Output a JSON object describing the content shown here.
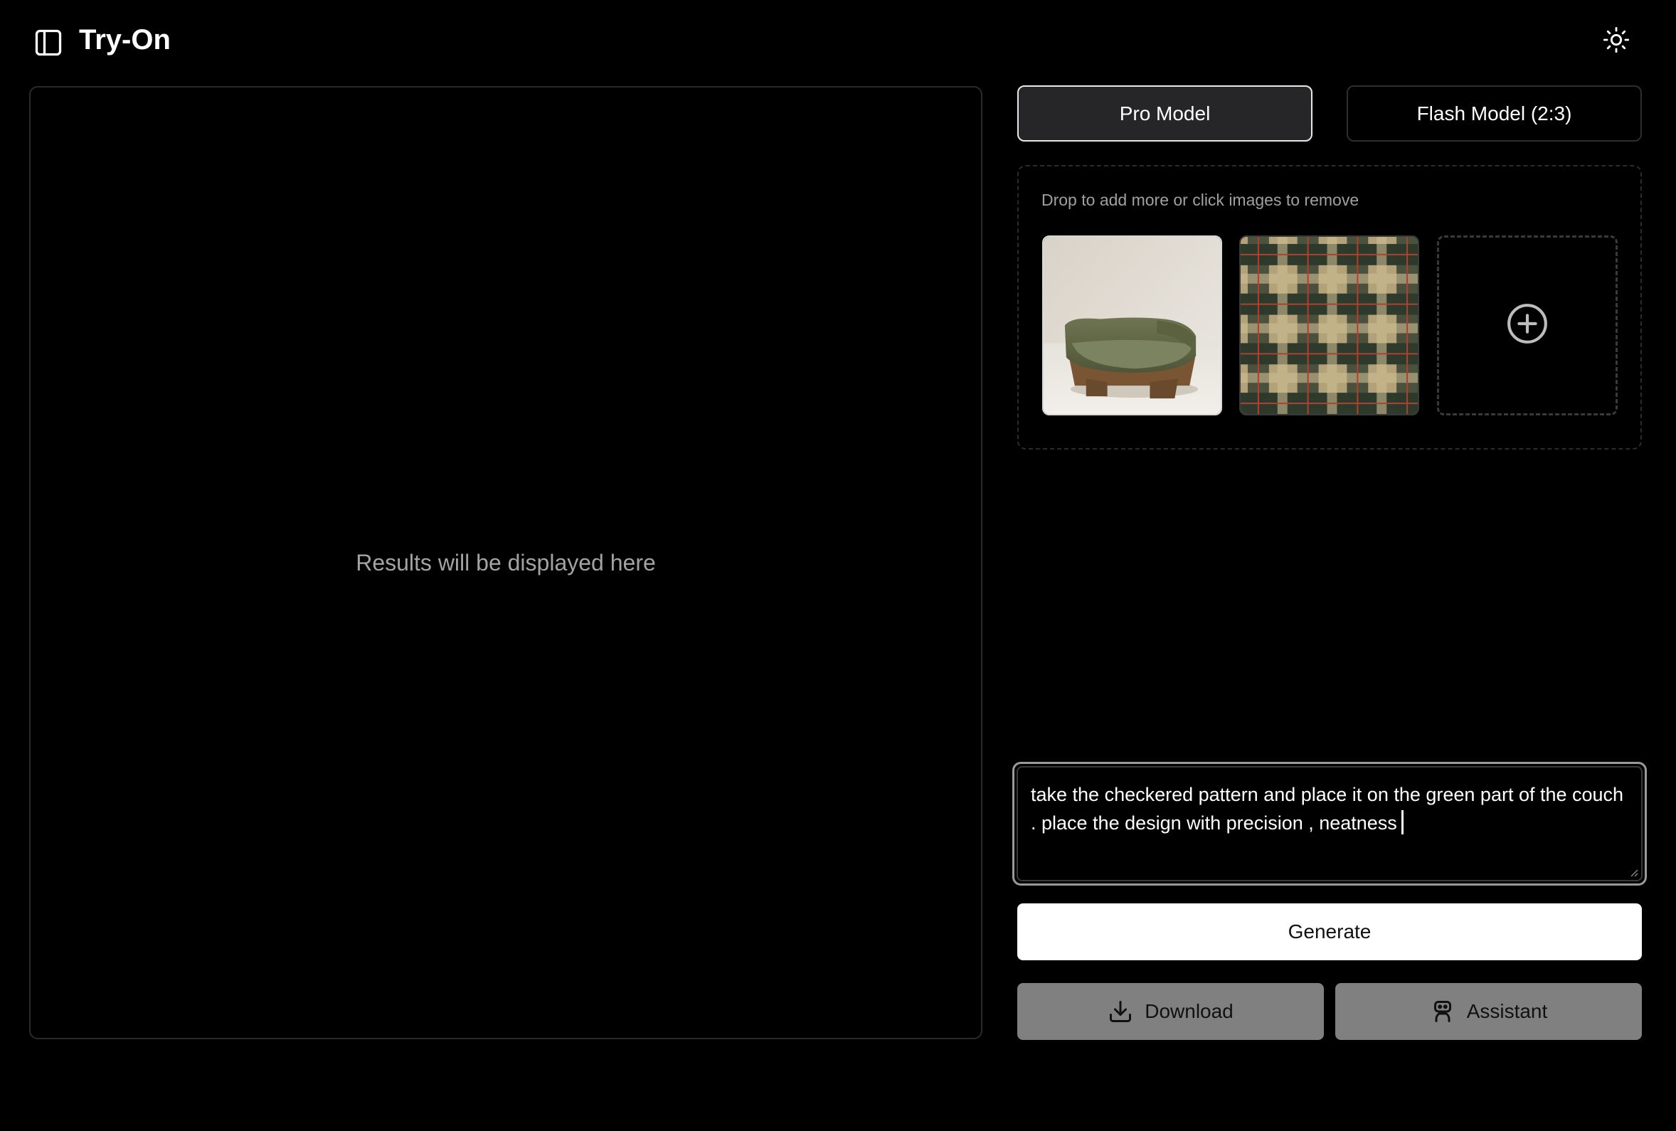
{
  "header": {
    "title": "Try-On",
    "sidebar_toggle_icon": "sidebar-panel-icon",
    "theme_toggle_icon": "sun-icon"
  },
  "results": {
    "placeholder": "Results will be displayed here"
  },
  "models": {
    "pro_label": "Pro Model",
    "flash_label": "Flash Model (2:3)",
    "selected": "Pro Model"
  },
  "dropzone": {
    "hint": "Drop to add more or click images to remove",
    "images": [
      {
        "name": "couch-image"
      },
      {
        "name": "plaid-pattern-image"
      }
    ],
    "add_icon": "plus-circle-icon"
  },
  "prompt": {
    "value": "take the checkered pattern and place it on the green part of the couch . place the design with precision , neatness"
  },
  "actions": {
    "generate_label": "Generate",
    "download_label": "Download",
    "download_icon": "download-icon",
    "assistant_label": "Assistant",
    "assistant_icon": "robot-icon"
  },
  "colors": {
    "background": "#000000",
    "text": "#ffffff",
    "muted_text": "#a3a3a3",
    "border": "#2a2a2a",
    "generate_bg": "#ffffff",
    "disabled_action_bg": "#808080"
  }
}
